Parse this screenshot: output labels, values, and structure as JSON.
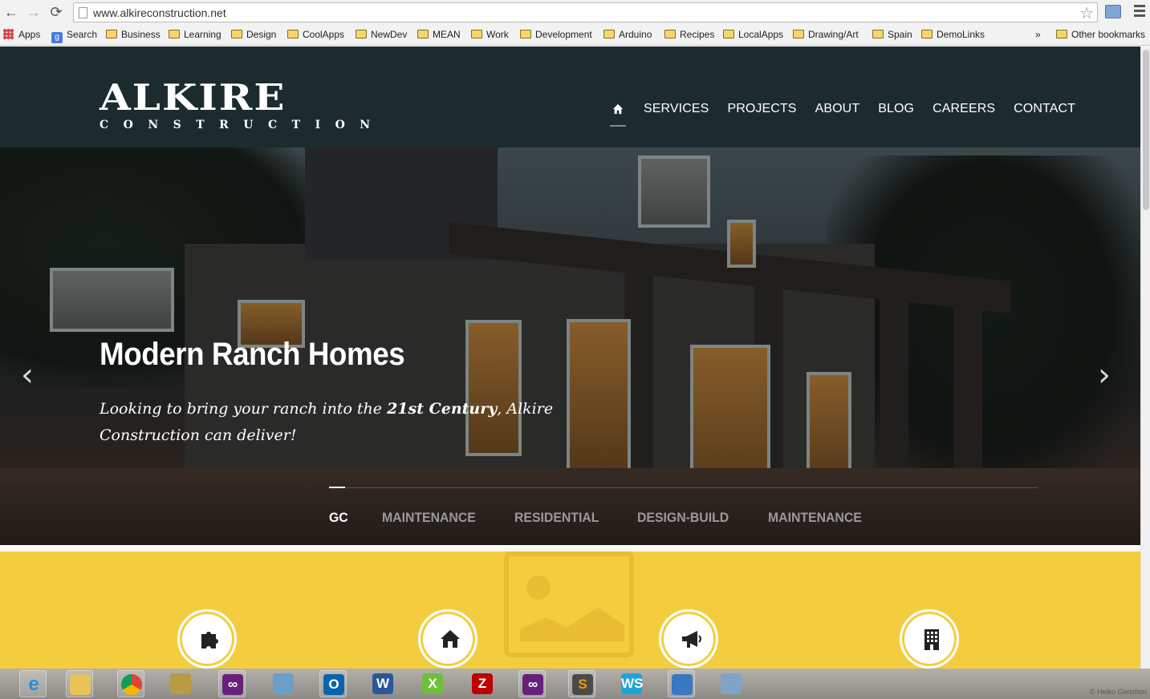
{
  "browser": {
    "url": "www.alkireconstruction.net",
    "bookmarks": [
      {
        "label": "Apps",
        "icon": "apps-grid-icon"
      },
      {
        "label": "Search",
        "icon": "google-icon"
      },
      {
        "label": "Business",
        "icon": "folder-icon"
      },
      {
        "label": "Learning",
        "icon": "folder-icon"
      },
      {
        "label": "Design",
        "icon": "folder-icon"
      },
      {
        "label": "CoolApps",
        "icon": "folder-icon"
      },
      {
        "label": "NewDev",
        "icon": "folder-icon"
      },
      {
        "label": "MEAN",
        "icon": "folder-icon"
      },
      {
        "label": "Work",
        "icon": "folder-icon"
      },
      {
        "label": "Development",
        "icon": "folder-icon"
      },
      {
        "label": "Arduino",
        "icon": "folder-icon"
      },
      {
        "label": "Recipes",
        "icon": "folder-icon"
      },
      {
        "label": "LocalApps",
        "icon": "folder-icon"
      },
      {
        "label": "Drawing/Art",
        "icon": "folder-icon"
      },
      {
        "label": "Spain",
        "icon": "folder-icon"
      },
      {
        "label": "DemoLinks",
        "icon": "folder-icon"
      }
    ],
    "overflow": "»",
    "other_bookmarks": "Other bookmarks"
  },
  "site": {
    "logo_main": "ALKIRE",
    "logo_sub": "CONSTRUCTION",
    "nav": [
      "SERVICES",
      "PROJECTS",
      "ABOUT",
      "BLOG",
      "CAREERS",
      "CONTACT"
    ],
    "nav_active": "home"
  },
  "hero": {
    "title": "Modern Ranch Homes",
    "text_before": "Looking to bring your ranch into the ",
    "text_bold": "21st Century",
    "text_after": ", Alkire Construction can deliver!",
    "prev_arrow": "‹",
    "next_arrow": "›",
    "tabs": [
      "GC",
      "MAINTENANCE",
      "RESIDENTIAL",
      "DESIGN-BUILD",
      "MAINTENANCE"
    ],
    "active_tab": 0
  },
  "features": {
    "icons": [
      "puzzle-icon",
      "home-icon",
      "megaphone-icon",
      "building-icon"
    ],
    "color": "#f4cd3f"
  },
  "taskbar": {
    "apps": [
      "internet-explorer-icon",
      "file-explorer-icon",
      "chrome-icon",
      "tools-icon",
      "visual-studio-icon",
      "folder-sync-icon",
      "outlook-icon",
      "word-icon",
      "xamarin-icon",
      "filezilla-icon",
      "visual-studio-2-icon",
      "sublime-text-icon",
      "webstorm-icon",
      "remote-desktop-icon",
      "virtualbox-icon"
    ],
    "credit": "© Heiko Gerichon"
  },
  "colors": {
    "header_bg": "#1c2b2e",
    "accent_yellow": "#f4cd3f"
  }
}
